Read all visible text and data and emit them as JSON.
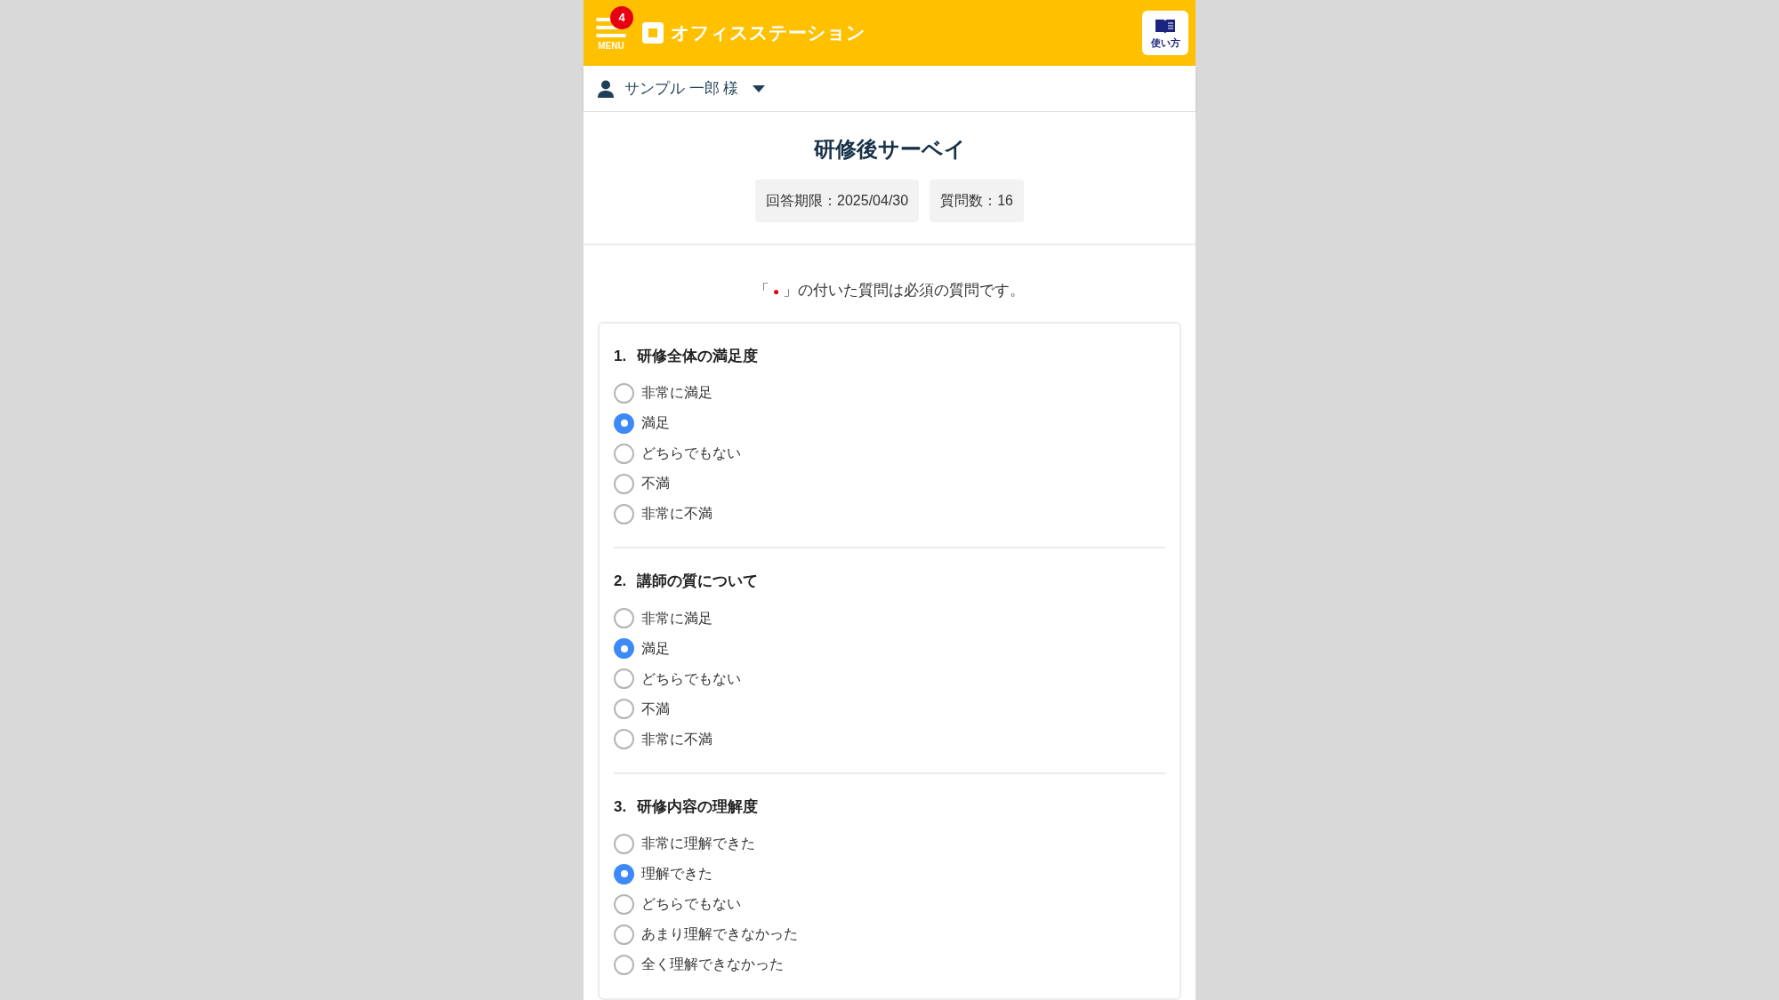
{
  "header": {
    "menu_label": "MENU",
    "menu_badge": "4",
    "logo_text": "オフィスステーション",
    "help_label": "使い方"
  },
  "user": {
    "name": "サンプル 一郎 様"
  },
  "survey": {
    "title": "研修後サーベイ",
    "meta": [
      "回答期限：2025/04/30",
      "質問数：16"
    ]
  },
  "notice": {
    "before": "「",
    "mark": "●",
    "after": "」の付いた質問は必須の質問です。"
  },
  "questions": [
    {
      "number": "1.",
      "title": "研修全体の満足度",
      "options": [
        {
          "label": "非常に満足",
          "selected": false
        },
        {
          "label": "満足",
          "selected": true
        },
        {
          "label": "どちらでもない",
          "selected": false
        },
        {
          "label": "不満",
          "selected": false
        },
        {
          "label": "非常に不満",
          "selected": false
        }
      ]
    },
    {
      "number": "2.",
      "title": "講師の質について",
      "options": [
        {
          "label": "非常に満足",
          "selected": false
        },
        {
          "label": "満足",
          "selected": true
        },
        {
          "label": "どちらでもない",
          "selected": false
        },
        {
          "label": "不満",
          "selected": false
        },
        {
          "label": "非常に不満",
          "selected": false
        }
      ]
    },
    {
      "number": "3.",
      "title": "研修内容の理解度",
      "options": [
        {
          "label": "非常に理解できた",
          "selected": false
        },
        {
          "label": "理解できた",
          "selected": true
        },
        {
          "label": "どちらでもない",
          "selected": false
        },
        {
          "label": "あまり理解できなかった",
          "selected": false
        },
        {
          "label": "全く理解できなかった",
          "selected": false
        }
      ]
    }
  ]
}
